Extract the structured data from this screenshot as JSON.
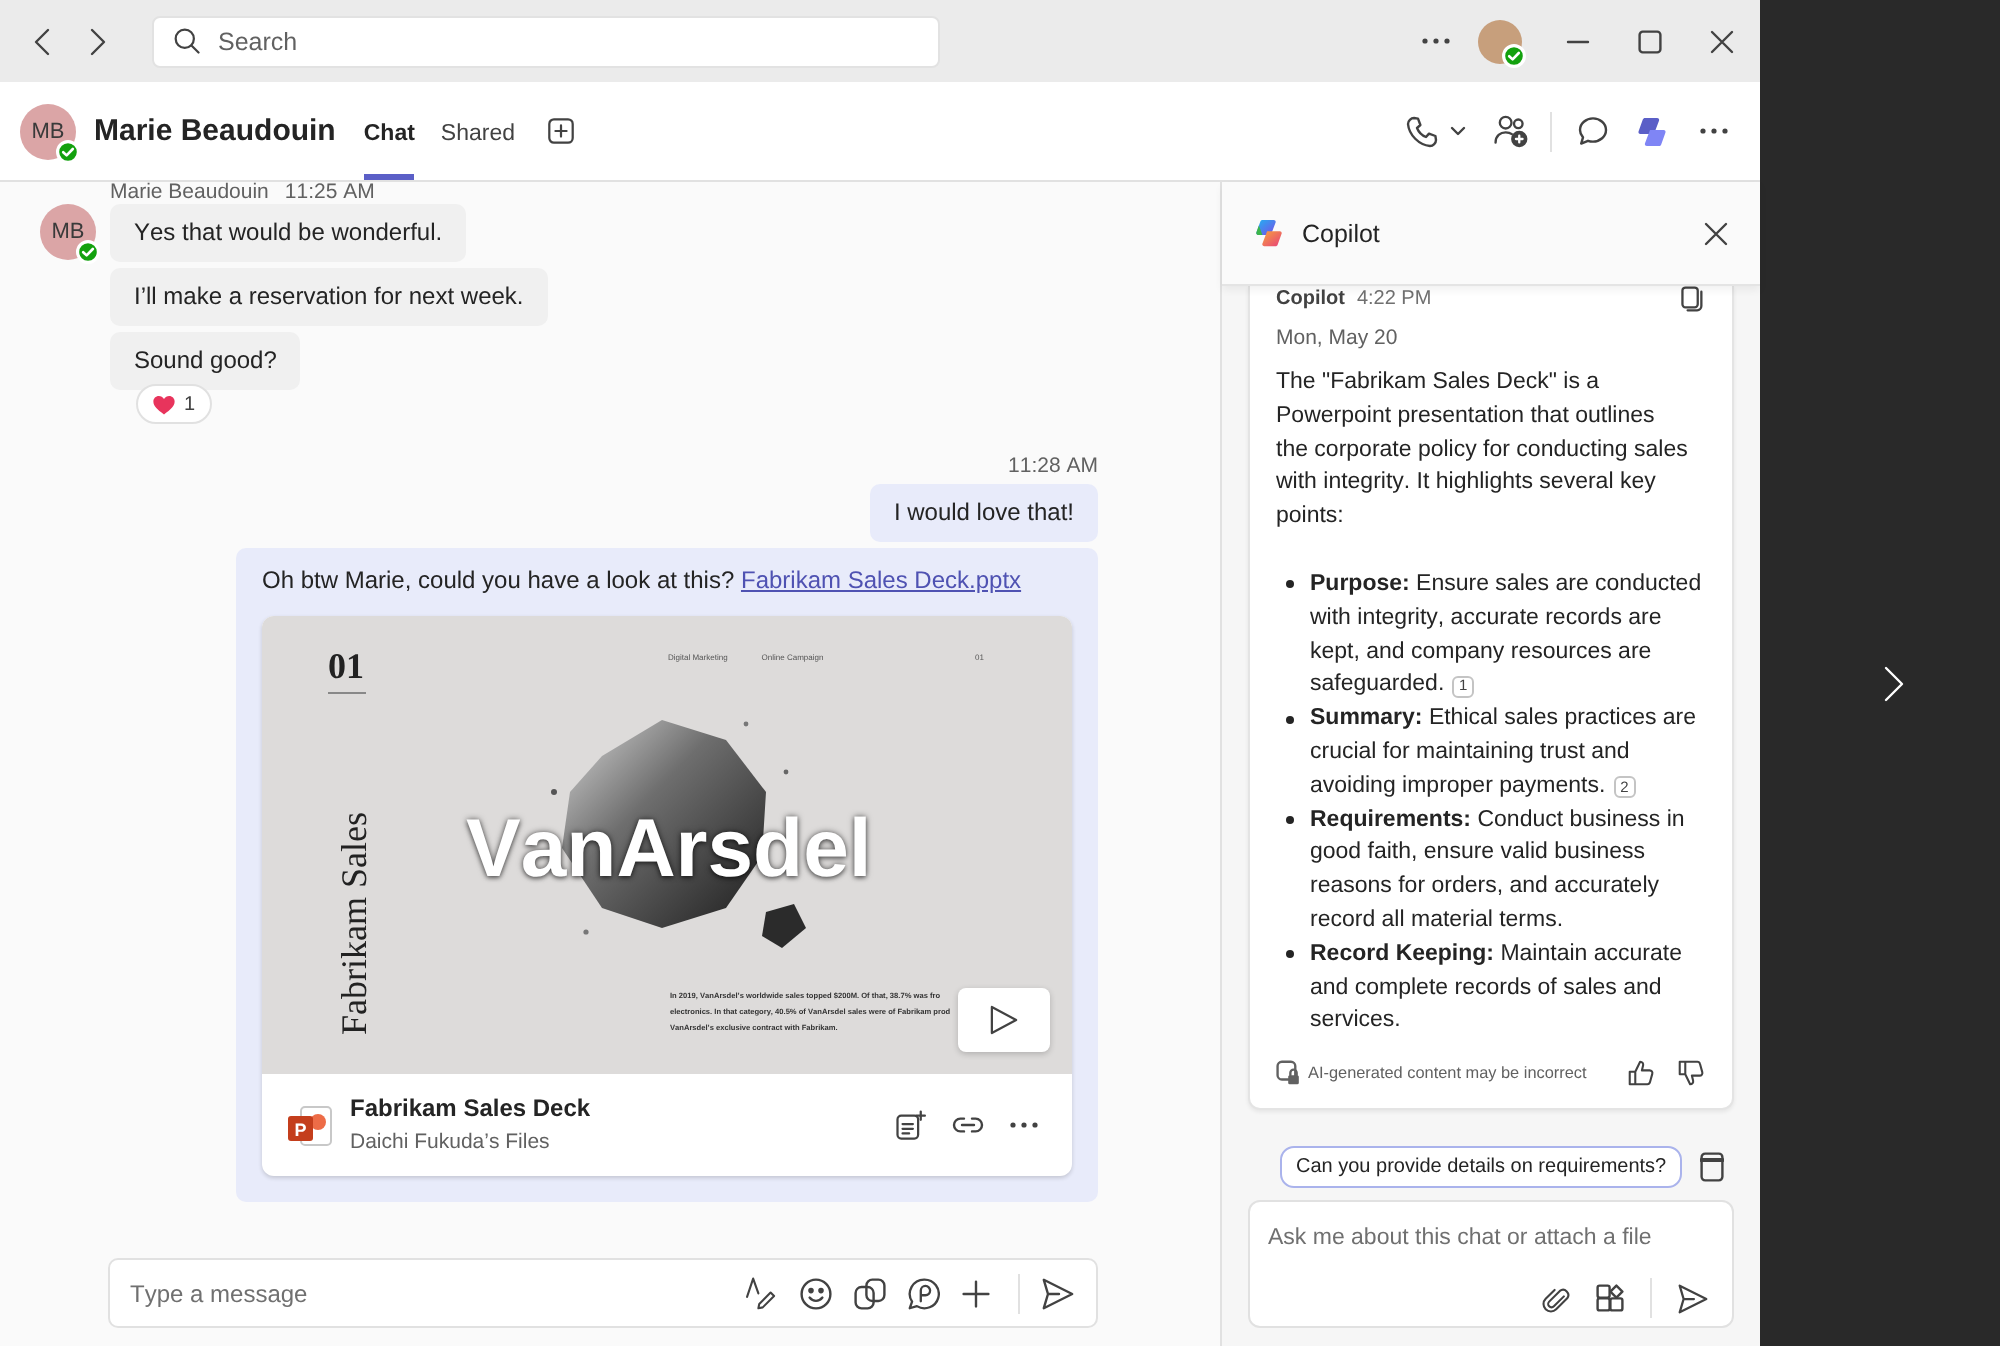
{
  "titlebar": {
    "search": {
      "placeholder": "Search"
    },
    "user": {
      "online": true
    }
  },
  "chat_header": {
    "avatar": {
      "initials": "MB",
      "online": true
    },
    "name": "Marie Beaudouin",
    "tabs": [
      {
        "label": "Chat",
        "selected": true
      },
      {
        "label": "Shared",
        "selected": false
      }
    ]
  },
  "messages": [
    {
      "kind": "incoming",
      "sender": "Marie Beaudouin",
      "time": "11:25 AM",
      "avatar": {
        "initials": "MB",
        "online": true
      },
      "bubbles": [
        {
          "text": "Yes that would be wonderful."
        },
        {
          "text": "I’ll make a reservation for next week."
        },
        {
          "text": "Sound good?",
          "reactions": [
            {
              "kind": "heart",
              "count": "1"
            }
          ]
        }
      ]
    },
    {
      "kind": "outgoing",
      "time": "11:28 AM",
      "bubbles": [
        {
          "text": "I would love that!"
        },
        {
          "text": "Oh btw Marie, could you have a look at this?",
          "link": "Fabrikam Sales Deck.pptx",
          "attachment": {
            "slide": {
              "number": "01",
              "tags": [
                "Digital Marketing",
                "Online Campaign",
                "01"
              ],
              "title": "Fabrikam Sales",
              "logo": "VanArsdel",
              "body": [
                "In 2019, VanArsdel’s worldwide sales topped $200M. Of that, 38.7% was fro",
                "electronics. In that category, 40.5% of VanArsdel sales were of Fabrikam prod",
                "VanArsdel’s exclusive contract with Fabrikam."
              ]
            },
            "file": {
              "icon_letter": "P",
              "name": "Fabrikam Sales Deck",
              "location": "Daichi Fukuda’s Files"
            }
          }
        }
      ]
    }
  ],
  "compose": {
    "placeholder": "Type a message"
  },
  "copilot": {
    "title": "Copilot",
    "response": {
      "sender": "Copilot",
      "time": "4:22 PM",
      "date": "Mon, May 20",
      "intro": "The \"Fabrikam Sales Deck\" is a Powerpoint presentation that outlines the corporate policy for conducting sales with integrity. It highlights several key points:",
      "points": [
        {
          "text": "**Purpose:** Ensure sales are conducted with integrity, accurate records are kept, and company resources are safeguarded.",
          "citation": "1"
        },
        {
          "text": "**Summary:** Ethical sales practices are crucial for maintaining trust and avoiding improper payments.",
          "citation": "2"
        },
        {
          "text": "**Requirements:** Conduct business in good faith, ensure valid business reasons for orders, and accurately record all material terms."
        },
        {
          "text": "**Record Keeping:** Maintain accurate and complete records of sales and services."
        }
      ],
      "disclaimer": "AI-generated content may be incorrect"
    },
    "suggestions": [
      "Can you provide details on requirements?"
    ],
    "input": {
      "placeholder": "Ask me about this chat or attach a file"
    }
  }
}
